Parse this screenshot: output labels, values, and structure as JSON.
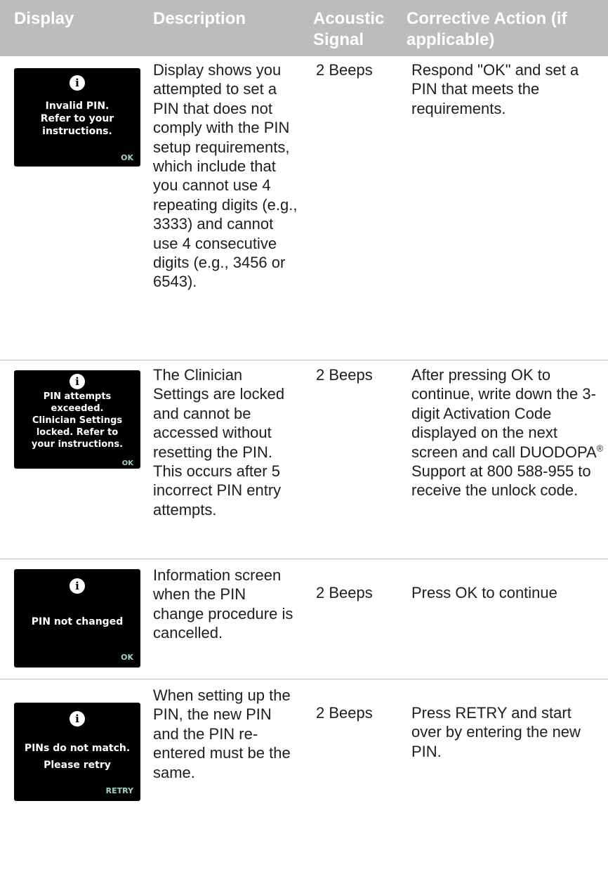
{
  "header": {
    "display": "Display",
    "description": "Description",
    "signal": "Acoustic Signal",
    "action": "Corrective Action (if applicable)"
  },
  "rows": [
    {
      "screen": {
        "icon": "info-icon",
        "message": "Invalid PIN.\nRefer to your\ninstructions.",
        "softkey": "OK"
      },
      "description": "Display shows you attempted to set a PIN that does not comply with the PIN setup requirements, which include that you cannot use 4 repeating digits (e.g., 3333) and cannot use 4 consecutive digits (e.g., 3456 or 6543).",
      "signal": "2 Beeps",
      "action": "Respond \"OK\" and set a PIN that meets the requirements."
    },
    {
      "screen": {
        "icon": "info-icon",
        "message": "PIN attempts\nexceeded.\nClinician Settings\nlocked. Refer to\nyour instructions.",
        "softkey": "OK"
      },
      "description": "The Clinician Settings are locked and cannot be accessed without resetting the PIN. This occurs after 5 incorrect PIN entry attempts.",
      "signal": "2 Beeps",
      "action_before": "After pressing OK to continue, write down the 3-digit Activation Code displayed on the next screen and call DUODOPA",
      "action_sup": "®",
      "action_after": " Support at 800 588-955 to receive the unlock code."
    },
    {
      "screen": {
        "icon": "info-icon",
        "message": "PIN not changed",
        "softkey": "OK"
      },
      "description": "Information screen when the PIN change procedure is cancelled.",
      "signal": "2 Beeps",
      "action": "Press OK to continue"
    },
    {
      "screen": {
        "icon": "info-icon",
        "message": "PINs do not match.\nPlease retry",
        "softkey": "RETRY"
      },
      "description": "When setting up the PIN, the new PIN and the PIN re-entered must be the same.",
      "signal": "2 Beeps",
      "action": "Press RETRY and start over by entering the new PIN."
    }
  ]
}
